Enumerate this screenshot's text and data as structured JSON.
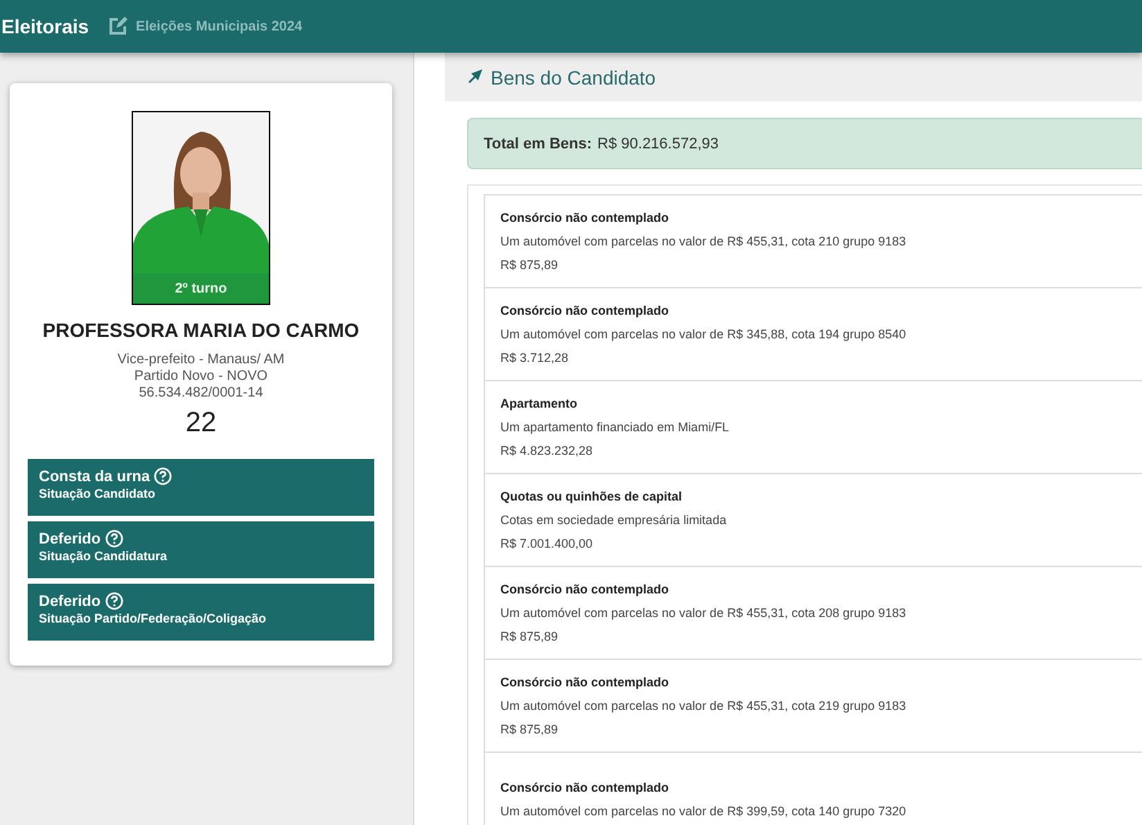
{
  "header": {
    "title": "Eleitorais",
    "subtitle": "Eleições Municipais 2024"
  },
  "candidate": {
    "round_badge": "2º turno",
    "name": "PROFESSORA MARIA DO CARMO",
    "details": [
      "Vice-prefeito - Manaus/ AM",
      "Partido Novo - NOVO",
      "56.534.482/0001-14"
    ],
    "number": "22",
    "statuses": [
      {
        "value": "Consta da urna",
        "label": "Situação Candidato"
      },
      {
        "value": "Deferido",
        "label": "Situação Candidatura"
      },
      {
        "value": "Deferido",
        "label": "Situação Partido/Federação/Coligação"
      }
    ]
  },
  "assets": {
    "title": "Bens do Candidato",
    "total_label": "Total em Bens:",
    "total_value": "R$ 90.216.572,93",
    "items": [
      {
        "type": "Consórcio não contemplado",
        "description": "Um automóvel com parcelas no valor de R$ 455,31, cota 210 grupo 9183",
        "value": "R$ 875,89"
      },
      {
        "type": "Consórcio não contemplado",
        "description": "Um automóvel com parcelas no valor de R$ 345,88, cota 194 grupo 8540",
        "value": "R$ 3.712,28"
      },
      {
        "type": "Apartamento",
        "description": "Um apartamento financiado em Miami/FL",
        "value": "R$ 4.823.232,28"
      },
      {
        "type": "Quotas ou quinhões de capital",
        "description": "Cotas em sociedade empresária limitada",
        "value": "R$ 7.001.400,00"
      },
      {
        "type": "Consórcio não contemplado",
        "description": "Um automóvel com parcelas no valor de R$ 455,31, cota 208 grupo 9183",
        "value": "R$ 875,89"
      },
      {
        "type": "Consórcio não contemplado",
        "description": "Um automóvel com parcelas no valor de R$ 455,31, cota 219 grupo 9183",
        "value": "R$ 875,89"
      },
      {
        "type": "Consórcio não contemplado",
        "description": "Um automóvel com parcelas no valor de R$ 399,59, cota 140 grupo 7320"
      }
    ]
  }
}
